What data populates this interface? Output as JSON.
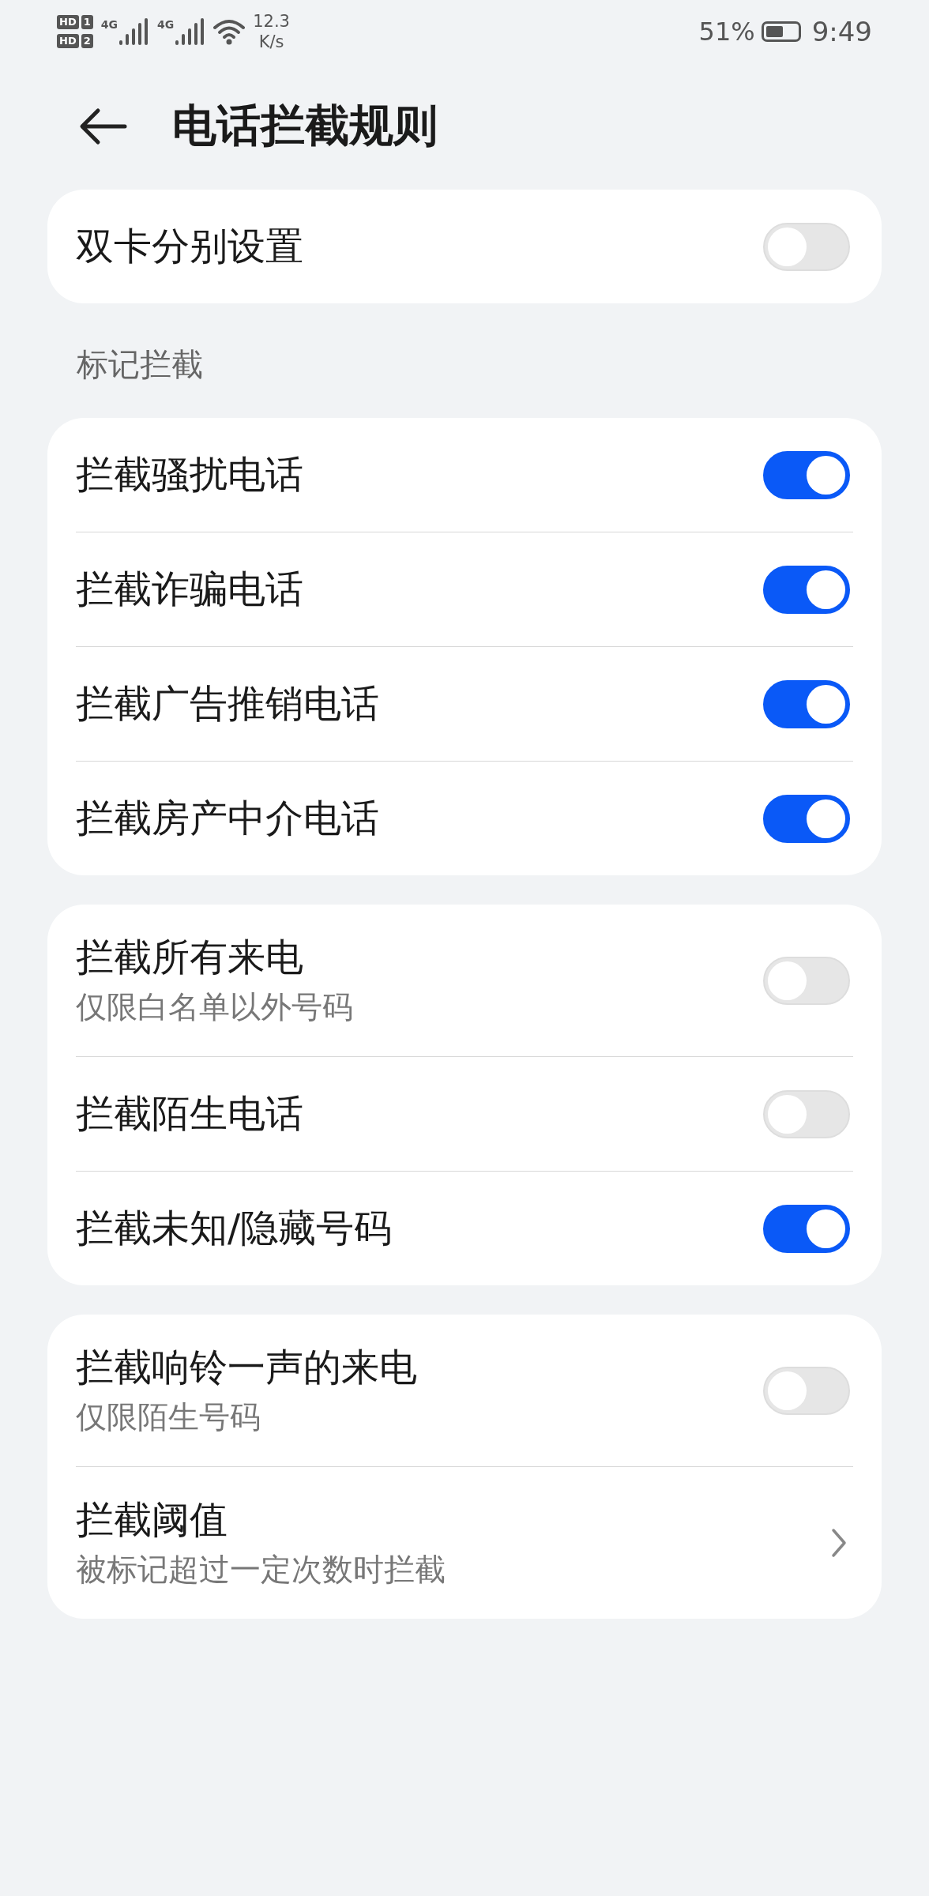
{
  "status_bar": {
    "sim_labels": [
      {
        "text": "HD",
        "slot": "1"
      },
      {
        "text": "HD",
        "slot": "2"
      }
    ],
    "network_types": [
      "4G",
      "4G"
    ],
    "speed_value": "12.3",
    "speed_unit": "K/s",
    "battery_percent": "51%",
    "time": "9:49"
  },
  "header": {
    "title": "电话拦截规则"
  },
  "cards": [
    {
      "items": [
        {
          "kind": "toggle",
          "label": "双卡分别设置",
          "on": false
        }
      ]
    },
    {
      "heading": "标记拦截",
      "items": [
        {
          "kind": "toggle",
          "label": "拦截骚扰电话",
          "on": true
        },
        {
          "kind": "toggle",
          "label": "拦截诈骗电话",
          "on": true
        },
        {
          "kind": "toggle",
          "label": "拦截广告推销电话",
          "on": true
        },
        {
          "kind": "toggle",
          "label": "拦截房产中介电话",
          "on": true
        }
      ]
    },
    {
      "items": [
        {
          "kind": "toggle",
          "label": "拦截所有来电",
          "sublabel": "仅限白名单以外号码",
          "on": false
        },
        {
          "kind": "toggle",
          "label": "拦截陌生电话",
          "on": false
        },
        {
          "kind": "toggle",
          "label": "拦截未知/隐藏号码",
          "on": true
        }
      ]
    },
    {
      "items": [
        {
          "kind": "toggle",
          "label": "拦截响铃一声的来电",
          "sublabel": "仅限陌生号码",
          "on": false
        },
        {
          "kind": "link",
          "label": "拦截阈值",
          "sublabel": "被标记超过一定次数时拦截"
        }
      ]
    }
  ]
}
